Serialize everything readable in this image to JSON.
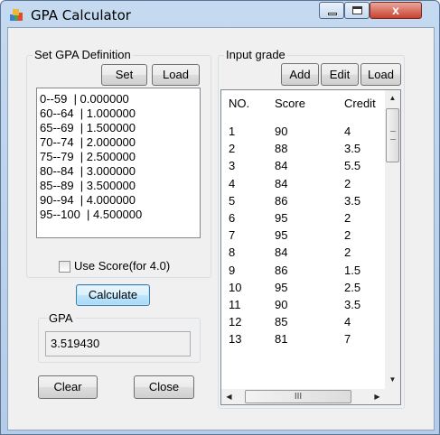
{
  "window": {
    "title": "GPA Calculator",
    "close_glyph": "x",
    "icon": "gpa-calculator-app-icon"
  },
  "gpa_definition": {
    "group_label": "Set GPA Definition",
    "set_label": "Set",
    "load_label": "Load",
    "rows": [
      "0--59  | 0.000000",
      "60--64  | 1.000000",
      "65--69  | 1.500000",
      "70--74  | 2.000000",
      "75--79  | 2.500000",
      "80--84  | 3.000000",
      "85--89  | 3.500000",
      "90--94  | 4.000000",
      "95--100  | 4.500000"
    ]
  },
  "use_score": {
    "label": "Use Score(for 4.0)",
    "checked": false
  },
  "calculate_label": "Calculate",
  "gpa": {
    "group_label": "GPA",
    "value": "3.519430"
  },
  "clear_label": "Clear",
  "close_label": "Close",
  "input_grade": {
    "group_label": "Input grade",
    "add_label": "Add",
    "edit_label": "Edit",
    "load_label": "Load",
    "columns": [
      "NO.",
      "Score",
      "Credit"
    ],
    "rows": [
      [
        "1",
        "90",
        "4"
      ],
      [
        "2",
        "88",
        "3.5"
      ],
      [
        "3",
        "84",
        "5.5"
      ],
      [
        "4",
        "84",
        "2"
      ],
      [
        "5",
        "86",
        "3.5"
      ],
      [
        "6",
        "95",
        "2"
      ],
      [
        "7",
        "95",
        "2"
      ],
      [
        "8",
        "84",
        "2"
      ],
      [
        "9",
        "86",
        "1.5"
      ],
      [
        "10",
        "95",
        "2.5"
      ],
      [
        "11",
        "90",
        "3.5"
      ],
      [
        "12",
        "85",
        "4"
      ],
      [
        "13",
        "81",
        "7"
      ]
    ],
    "hscroll_grip": "III"
  },
  "colors": {
    "title_bg": "#c5daf0",
    "close_button": "#c9412e",
    "focus_border": "#3c7fb1"
  }
}
